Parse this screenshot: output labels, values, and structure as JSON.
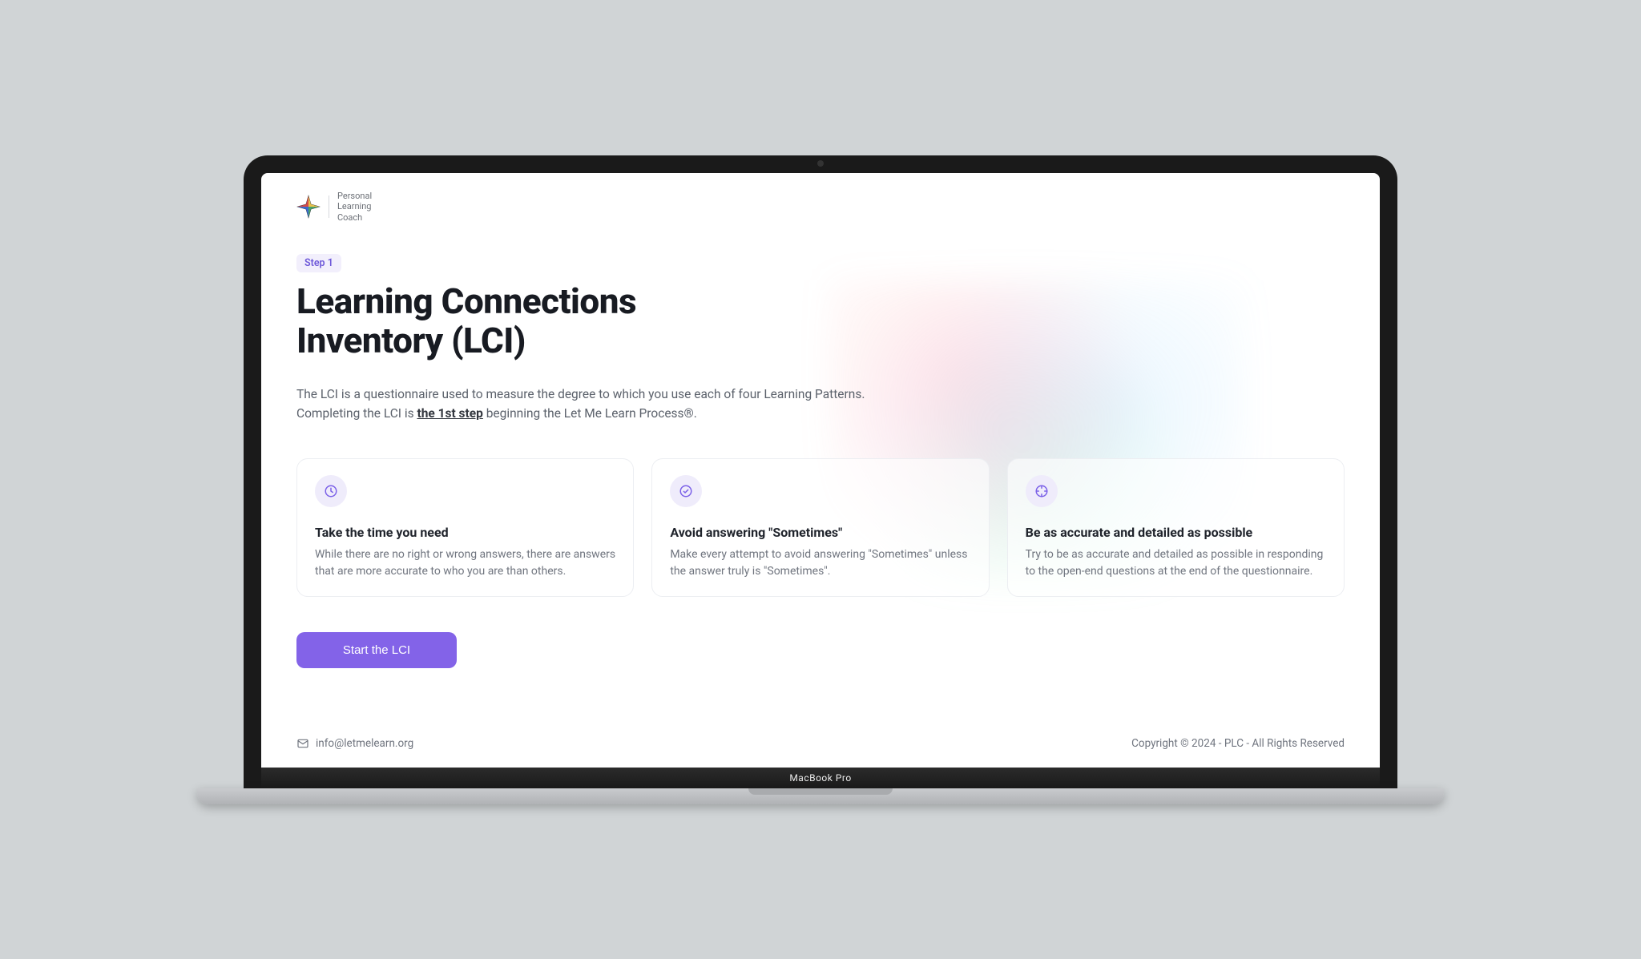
{
  "brand": {
    "line1": "Personal",
    "line2": "Learning",
    "line3": "Coach"
  },
  "step_badge": "Step 1",
  "title": "Learning Connections Inventory (LCI)",
  "intro": {
    "pre": "The LCI is a questionnaire used to measure the degree to which you use each of four Learning Patterns. Completing the LCI is ",
    "emph": "the 1st step",
    "post": " beginning the Let Me Learn Process®."
  },
  "cards": [
    {
      "icon": "clock-icon",
      "title": "Take the time you need",
      "body": "While there are no right or wrong answers, there are answers that are more accurate to who you are than others."
    },
    {
      "icon": "check-circle-icon",
      "title": "Avoid answering \"Sometimes\"",
      "body": "Make every attempt to avoid answering \"Sometimes\" unless the answer truly is \"Sometimes\"."
    },
    {
      "icon": "target-icon",
      "title": "Be as accurate and detailed as possible",
      "body": "Try to be as accurate and detailed as possible in responding to the open-end questions at the end of the questionnaire."
    }
  ],
  "start_label": "Start the LCI",
  "footer": {
    "email": "info@letmelearn.org",
    "copyright": "Copyright © 2024 - PLC - All Rights Reserved"
  },
  "device_label": "MacBook Pro"
}
